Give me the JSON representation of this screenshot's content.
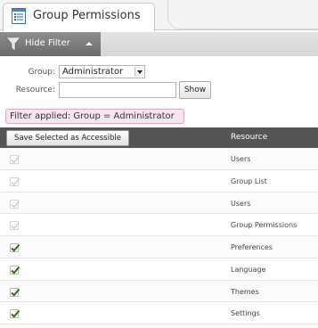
{
  "tab": {
    "title": "Group Permissions",
    "icon": "table-list-icon"
  },
  "filter": {
    "toggle_label": "Hide Filter",
    "group_label": "Group:",
    "group_value": "Administrator",
    "resource_label": "Resource:",
    "resource_value": "",
    "show_label": "Show",
    "applied_text": "Filter applied: Group = Administrator"
  },
  "table": {
    "save_label": "Save Selected as Accessible",
    "resource_header": "Resource",
    "rows": [
      {
        "name": "Users",
        "checked": true,
        "disabled": true
      },
      {
        "name": "Group List",
        "checked": true,
        "disabled": true
      },
      {
        "name": "Users",
        "checked": true,
        "disabled": true
      },
      {
        "name": "Group Permissions",
        "checked": true,
        "disabled": true
      },
      {
        "name": "Preferences",
        "checked": true,
        "disabled": false
      },
      {
        "name": "Language",
        "checked": true,
        "disabled": false
      },
      {
        "name": "Themes",
        "checked": true,
        "disabled": false
      },
      {
        "name": "Settings",
        "checked": true,
        "disabled": false
      }
    ]
  },
  "colors": {
    "header_bg": "#555555",
    "check_active": "#2e6e12",
    "check_disabled": "#c8c8c8",
    "badge_bg": "#f4e6ef",
    "badge_border": "#d9a8c4"
  }
}
